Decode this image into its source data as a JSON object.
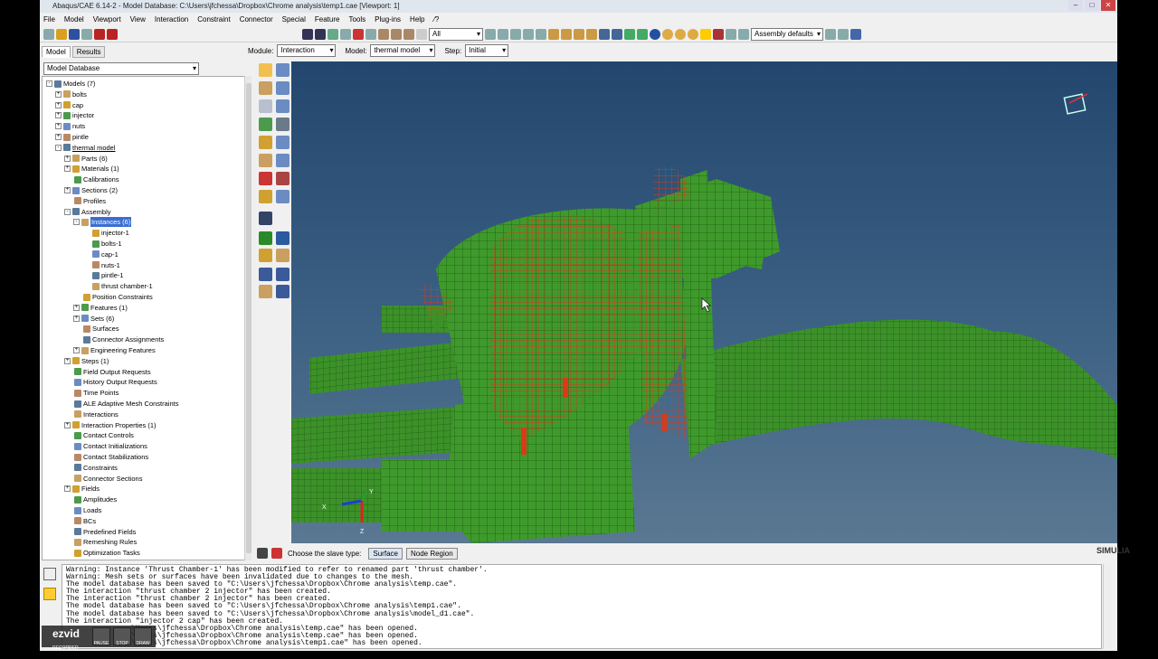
{
  "window": {
    "title": "Abaqus/CAE 6.14-2 - Model Database: C:\\Users\\jfchessa\\Dropbox\\Chrome analysis\\temp1.cae [Viewport: 1]"
  },
  "menu": [
    "File",
    "Model",
    "Viewport",
    "View",
    "Interaction",
    "Constraint",
    "Connector",
    "Special",
    "Feature",
    "Tools",
    "Plug-ins",
    "Help",
    "⁄?"
  ],
  "toolbar": {
    "filter_value": "All",
    "render_style": "Assembly defaults"
  },
  "context": {
    "module_label": "Module:",
    "module_value": "Interaction",
    "model_label": "Model:",
    "model_value": "thermal model",
    "step_label": "Step:",
    "step_value": "Initial"
  },
  "tabs": [
    "Model",
    "Results"
  ],
  "tree": {
    "db": "Model Database",
    "items": [
      {
        "t": "Models (7)",
        "d": 0,
        "e": "-"
      },
      {
        "t": "bolts",
        "d": 1,
        "e": "+"
      },
      {
        "t": "cap",
        "d": 1,
        "e": "+"
      },
      {
        "t": "injector",
        "d": 1,
        "e": "+"
      },
      {
        "t": "nuts",
        "d": 1,
        "e": "+"
      },
      {
        "t": "pintle",
        "d": 1,
        "e": "+"
      },
      {
        "t": "thermal model",
        "d": 1,
        "e": "-",
        "u": true
      },
      {
        "t": "Parts (6)",
        "d": 2,
        "e": "+"
      },
      {
        "t": "Materials (1)",
        "d": 2,
        "e": "+"
      },
      {
        "t": "Calibrations",
        "d": 2,
        "e": ""
      },
      {
        "t": "Sections (2)",
        "d": 2,
        "e": "+"
      },
      {
        "t": "Profiles",
        "d": 2,
        "e": ""
      },
      {
        "t": "Assembly",
        "d": 2,
        "e": "-"
      },
      {
        "t": "Instances (6)",
        "d": 3,
        "e": "-",
        "h": true
      },
      {
        "t": "injector-1",
        "d": 4,
        "e": ""
      },
      {
        "t": "bolts-1",
        "d": 4,
        "e": ""
      },
      {
        "t": "cap-1",
        "d": 4,
        "e": ""
      },
      {
        "t": "nuts-1",
        "d": 4,
        "e": ""
      },
      {
        "t": "pintle-1",
        "d": 4,
        "e": ""
      },
      {
        "t": "thrust chamber-1",
        "d": 4,
        "e": ""
      },
      {
        "t": "Position Constraints",
        "d": 3,
        "e": ""
      },
      {
        "t": "Features (1)",
        "d": 3,
        "e": "+"
      },
      {
        "t": "Sets (6)",
        "d": 3,
        "e": "+"
      },
      {
        "t": "Surfaces",
        "d": 3,
        "e": ""
      },
      {
        "t": "Connector Assignments",
        "d": 3,
        "e": ""
      },
      {
        "t": "Engineering Features",
        "d": 3,
        "e": "+"
      },
      {
        "t": "Steps (1)",
        "d": 2,
        "e": "+"
      },
      {
        "t": "Field Output Requests",
        "d": 2,
        "e": ""
      },
      {
        "t": "History Output Requests",
        "d": 2,
        "e": ""
      },
      {
        "t": "Time Points",
        "d": 2,
        "e": ""
      },
      {
        "t": "ALE Adaptive Mesh Constraints",
        "d": 2,
        "e": ""
      },
      {
        "t": "Interactions",
        "d": 2,
        "e": ""
      },
      {
        "t": "Interaction Properties (1)",
        "d": 2,
        "e": "+"
      },
      {
        "t": "Contact Controls",
        "d": 2,
        "e": ""
      },
      {
        "t": "Contact Initializations",
        "d": 2,
        "e": ""
      },
      {
        "t": "Contact Stabilizations",
        "d": 2,
        "e": ""
      },
      {
        "t": "Constraints",
        "d": 2,
        "e": ""
      },
      {
        "t": "Connector Sections",
        "d": 2,
        "e": ""
      },
      {
        "t": "Fields",
        "d": 2,
        "e": "+"
      },
      {
        "t": "Amplitudes",
        "d": 2,
        "e": ""
      },
      {
        "t": "Loads",
        "d": 2,
        "e": ""
      },
      {
        "t": "BCs",
        "d": 2,
        "e": ""
      },
      {
        "t": "Predefined Fields",
        "d": 2,
        "e": ""
      },
      {
        "t": "Remeshing Rules",
        "d": 2,
        "e": ""
      },
      {
        "t": "Optimization Tasks",
        "d": 2,
        "e": ""
      }
    ]
  },
  "prompt": {
    "text": "Choose the slave type:",
    "opt1": "Surface",
    "opt2": "Node Region"
  },
  "messages": [
    "Warning: Instance 'Thrust Chamber-1' has been modified to refer to renamed part 'thrust chamber'.",
    "Warning: Mesh sets or surfaces have been invalidated due to changes to the mesh.",
    "The model database has been saved to \"C:\\Users\\jfchessa\\Dropbox\\Chrome analysis\\temp.cae\".",
    "The interaction \"thrust chamber 2 injector\" has been created.",
    "The interaction \"thrust chamber 2 injector\" has been created.",
    "The model database has been saved to \"C:\\Users\\jfchessa\\Dropbox\\Chrome analysis\\temp1.cae\".",
    "The model database has been saved to \"C:\\Users\\jfchessa\\Dropbox\\Chrome analysis\\model_d1.cae\".",
    "The interaction \"injector 2 cap\" has been created.",
    "               \\Users\\jfchessa\\Dropbox\\Chrome analysis\\temp.cae\" has been opened.",
    "               \\Users\\jfchessa\\Dropbox\\Chrome analysis\\temp.cae\" has been opened.",
    "               \\Users\\jfchessa\\Dropbox\\Chrome analysis\\temp1.cae\" has been opened."
  ],
  "brand": {
    "simulia": "SIMULIA",
    "ezvid": "ezvid",
    "ezvid_sub": "RECORDER",
    "pause": "PAUSE",
    "stop": "STOP",
    "draw": "DRAW"
  },
  "triad": {
    "x": "X",
    "y": "Y",
    "z": "Z"
  },
  "colors": {
    "mesh_green": "#3f9a2c",
    "mesh_red": "#d93a1a",
    "bg_top": "#23466e",
    "bg_bottom": "#5a7892",
    "highlight": "#3a6fd1"
  }
}
